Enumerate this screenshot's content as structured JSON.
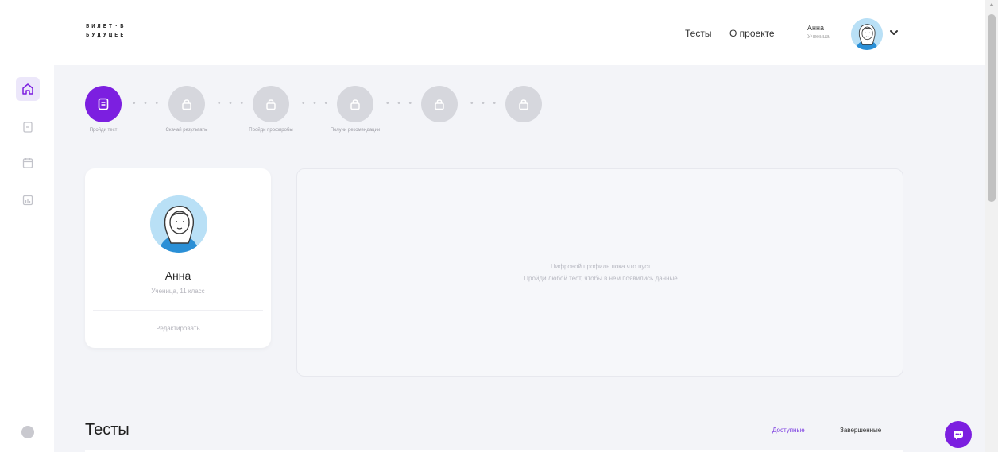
{
  "header": {
    "logo_line1": "БИЛЕТ·В",
    "logo_line2": "БУДУЩЕЕ",
    "nav": {
      "tests": "Тесты",
      "about": "О проекте"
    },
    "user": {
      "name": "Анна",
      "role": "Ученица"
    }
  },
  "sidebar": {
    "items": [
      {
        "icon": "home-icon",
        "active": true
      },
      {
        "icon": "document-icon",
        "active": false
      },
      {
        "icon": "calendar-icon",
        "active": false
      },
      {
        "icon": "chart-icon",
        "active": false
      }
    ],
    "help_icon": "help-icon"
  },
  "stepper": {
    "steps": [
      {
        "label": "Пройди тест",
        "icon": "document-icon",
        "state": "active"
      },
      {
        "label": "Скачай результаты",
        "icon": "lock-icon",
        "state": "locked"
      },
      {
        "label": "Пройди профпробы",
        "icon": "lock-icon",
        "state": "locked"
      },
      {
        "label": "Получи рекомендации",
        "icon": "lock-icon",
        "state": "locked"
      },
      {
        "label": "",
        "icon": "lock-icon",
        "state": "locked"
      },
      {
        "label": "",
        "icon": "lock-icon",
        "state": "locked"
      }
    ],
    "separator": "• • •"
  },
  "profile": {
    "name": "Анна",
    "role": "Ученица, 11 класс",
    "edit": "Редактировать"
  },
  "digital_profile": {
    "line1": "Цифровой профиль пока что пуст",
    "line2": "Пройди любой тест, чтобы в нем появились данные"
  },
  "tests": {
    "title": "Тесты",
    "tab_available": "Доступные",
    "tab_completed": "Завершенные"
  },
  "colors": {
    "accent": "#7c1fe0",
    "page_bg": "#f3f4f8",
    "locked_step": "#d6d7dd"
  }
}
